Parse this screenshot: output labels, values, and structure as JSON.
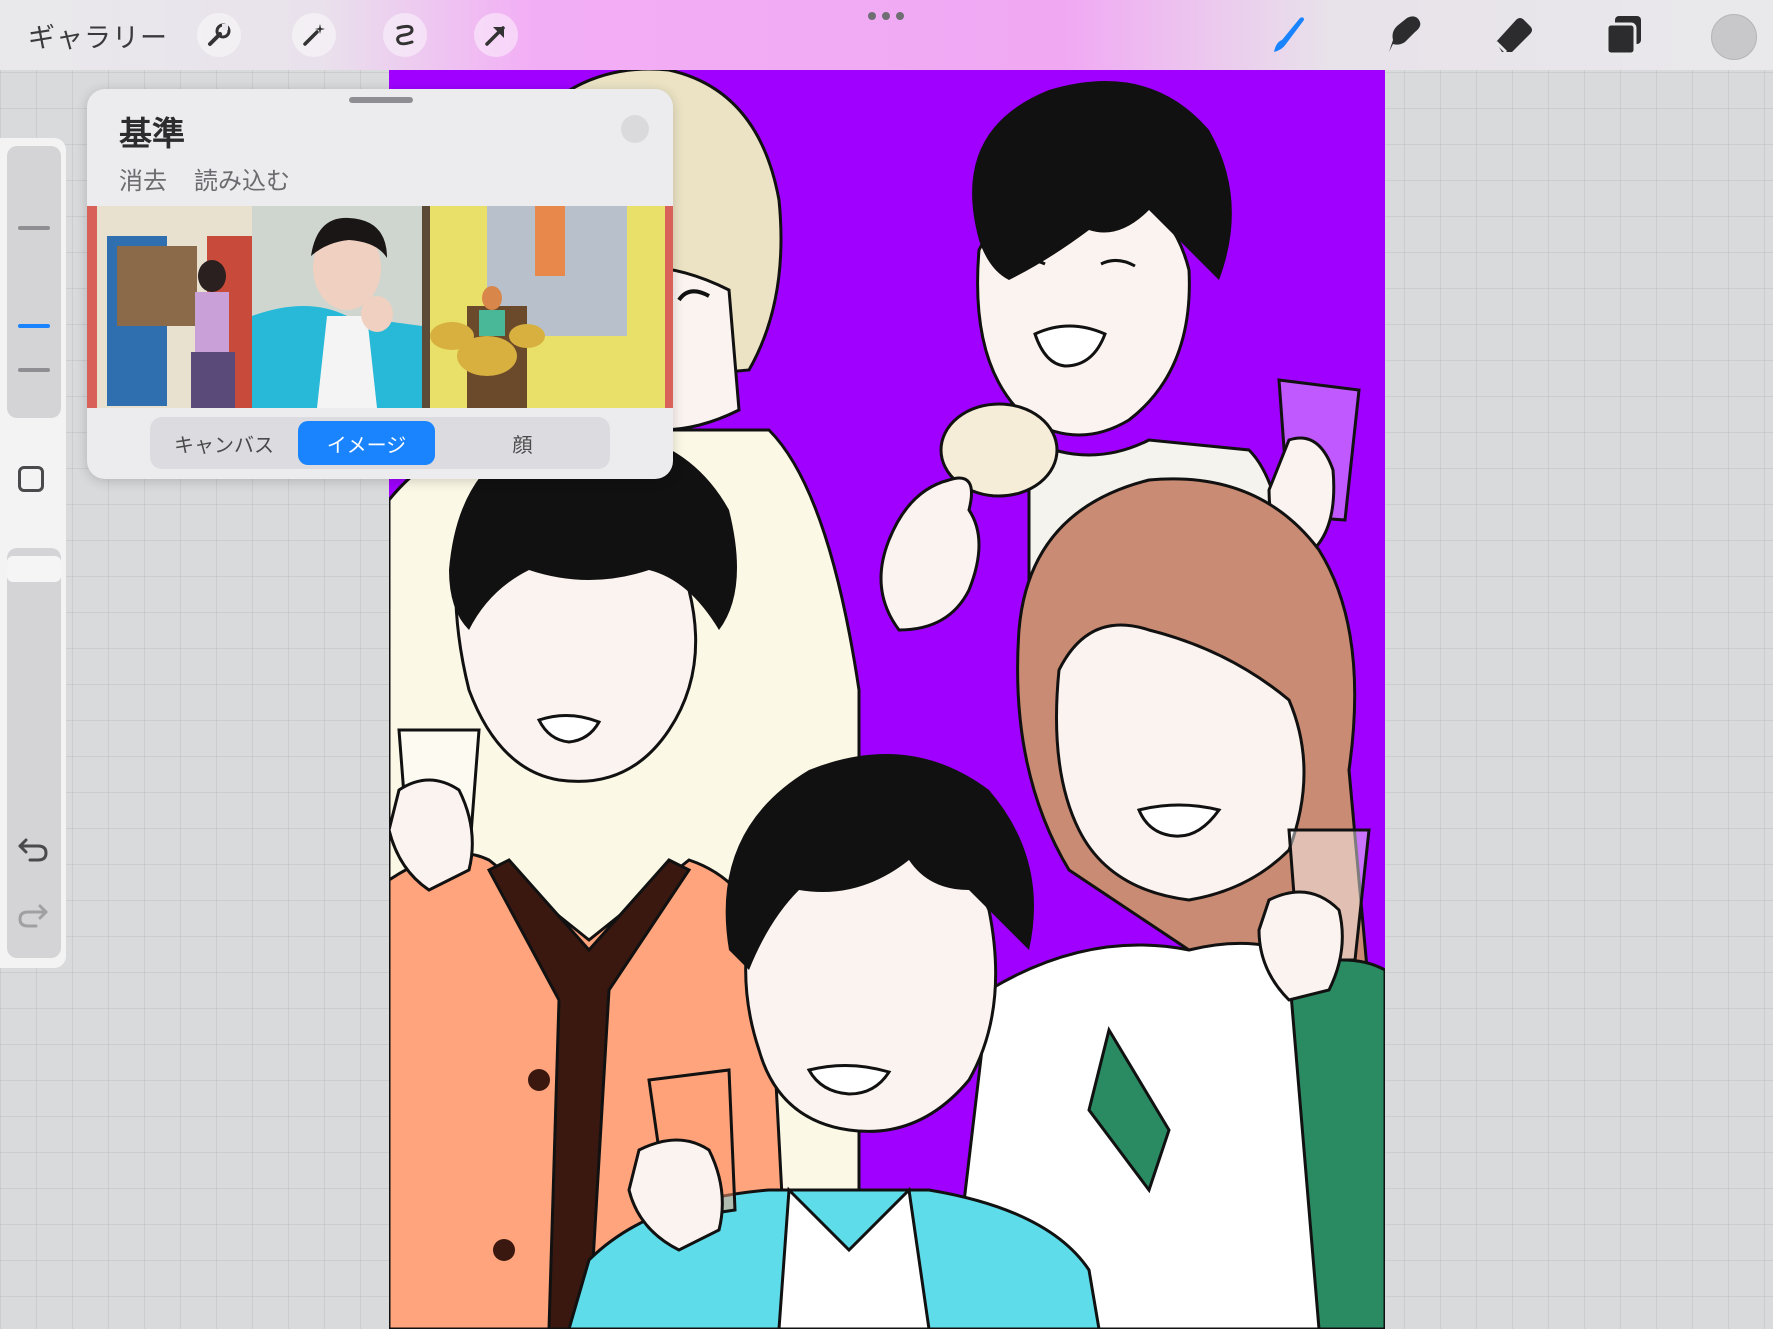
{
  "toolbar": {
    "gallery_label": "ギャラリー",
    "left_tools": [
      {
        "name": "wrench-icon"
      },
      {
        "name": "magic-wand-icon"
      },
      {
        "name": "selection-icon"
      },
      {
        "name": "transform-arrow-icon"
      }
    ],
    "right_tools": [
      {
        "name": "brush-icon",
        "active": true
      },
      {
        "name": "smudge-icon",
        "active": false
      },
      {
        "name": "eraser-icon",
        "active": false
      },
      {
        "name": "layers-icon",
        "active": false
      }
    ],
    "more_menu_icon": "ellipsis-icon",
    "current_color": "#c8c8ca",
    "active_color": "#1a84ff"
  },
  "sidebar": {
    "brush_size_level": 0.55,
    "opacity_level": 0.02,
    "modify_icon": "square-icon",
    "undo_icon": "undo-icon",
    "redo_icon": "redo-icon"
  },
  "reference_panel": {
    "title": "基準",
    "clear_label": "消去",
    "import_label": "読み込む",
    "tabs": [
      {
        "label": "キャンバス",
        "selected": false
      },
      {
        "label": "イメージ",
        "selected": true
      },
      {
        "label": "顔",
        "selected": false
      }
    ],
    "selected_color": "#1a84ff"
  },
  "canvas": {
    "background_color": "#9f00ff"
  }
}
